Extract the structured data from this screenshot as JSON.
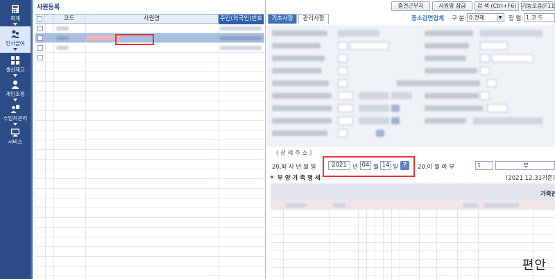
{
  "sidebar": {
    "items": [
      {
        "label": "회계",
        "icon": "calculator-icon",
        "active": false
      },
      {
        "label": "인사급여",
        "icon": "people-icon",
        "active": true
      },
      {
        "label": "생산재고",
        "icon": "grid-icon",
        "active": false
      },
      {
        "label": "개인조정",
        "icon": "person-icon",
        "active": false
      },
      {
        "label": "수임처관리",
        "icon": "group-icon",
        "active": false
      },
      {
        "label": "서비스",
        "icon": "monitor-icon",
        "active": false
      }
    ]
  },
  "list": {
    "title": "사원등록",
    "columns": [
      "",
      "코드",
      "사원명",
      "주민(외국인)번호"
    ]
  },
  "toolbar": {
    "buttons": [
      "중견근무지",
      "사원명 잠금",
      "검 색 (Ctrl+F6)",
      "기능모음(F11)"
    ]
  },
  "tabs": [
    "기초사항",
    "관리사항"
  ],
  "header": {
    "sme_label": "중소감면업체",
    "division_label": "구 분:",
    "division_value": "0.전체",
    "sort_label": "정 렬:",
    "sort_value": "1.코 드"
  },
  "form": {
    "notice": "( 상 세 주 소 )",
    "retire_label": "20.퇴 사 년 월 일",
    "retire_year": "2021",
    "year_unit": "년",
    "retire_month": "04",
    "month_unit": "월",
    "retire_day": "14",
    "day_unit": "일",
    "help_mark": "?",
    "active_label": "20.이 월 여 부",
    "active_value": "1",
    "active_text": "부",
    "family_label": "부 양 가 족 명 세",
    "family_date": "(2021.12.31기준)",
    "family_col_last": "가족관계"
  },
  "watermark": "편안"
}
